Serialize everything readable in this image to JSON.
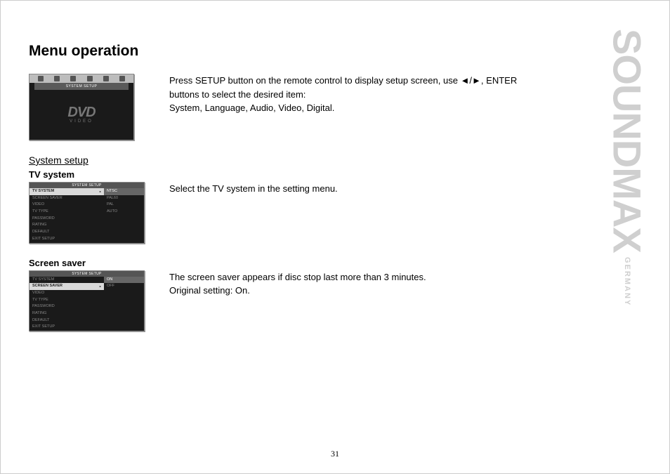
{
  "title": "Menu operation",
  "intro": {
    "line1_prefix": "Press SETUP button on the remote control to display setup screen, use ",
    "line1_suffix": ", ENTER buttons to select the desired item:",
    "line2": "System, Language, Audio, Video, Digital."
  },
  "dvd": {
    "header": "SYSTEM SETUP",
    "logo": "DVD",
    "logo_sub": "VIDEO"
  },
  "section_heading": "System setup",
  "tv_system": {
    "heading": "TV system",
    "desc": "Select the TV system in the setting menu.",
    "menu_header": "SYSTEM SETUP",
    "left_items": [
      "TV SYSTEM",
      "SCREEN SAVER",
      "VIDEO",
      "TV TYPE",
      "PASSWORD",
      "RATING",
      "DEFAULT",
      "EXIT  SETUP"
    ],
    "right_items": [
      "NTSC",
      "PAL60",
      "PAL",
      "AUTO"
    ],
    "selected_left": 0,
    "selected_right": 0
  },
  "screen_saver": {
    "heading": "Screen saver",
    "desc1": "The screen saver appears if disc stop last more than 3 minutes.",
    "desc2": "Original setting: On.",
    "menu_header": "SYSTEM SETUP",
    "left_items": [
      "TV SYSTEM",
      "SCREEN SAVER",
      "VIDEO",
      "TV TYPE",
      "PASSWORD",
      "RATING",
      "DEFAULT",
      "EXIT  SETUP"
    ],
    "right_items": [
      "ON",
      "OFF"
    ],
    "selected_left": 1,
    "selected_right": 0
  },
  "page_number": "31",
  "brand": "SOUNDMAX",
  "brand_sub": "GERMANY"
}
